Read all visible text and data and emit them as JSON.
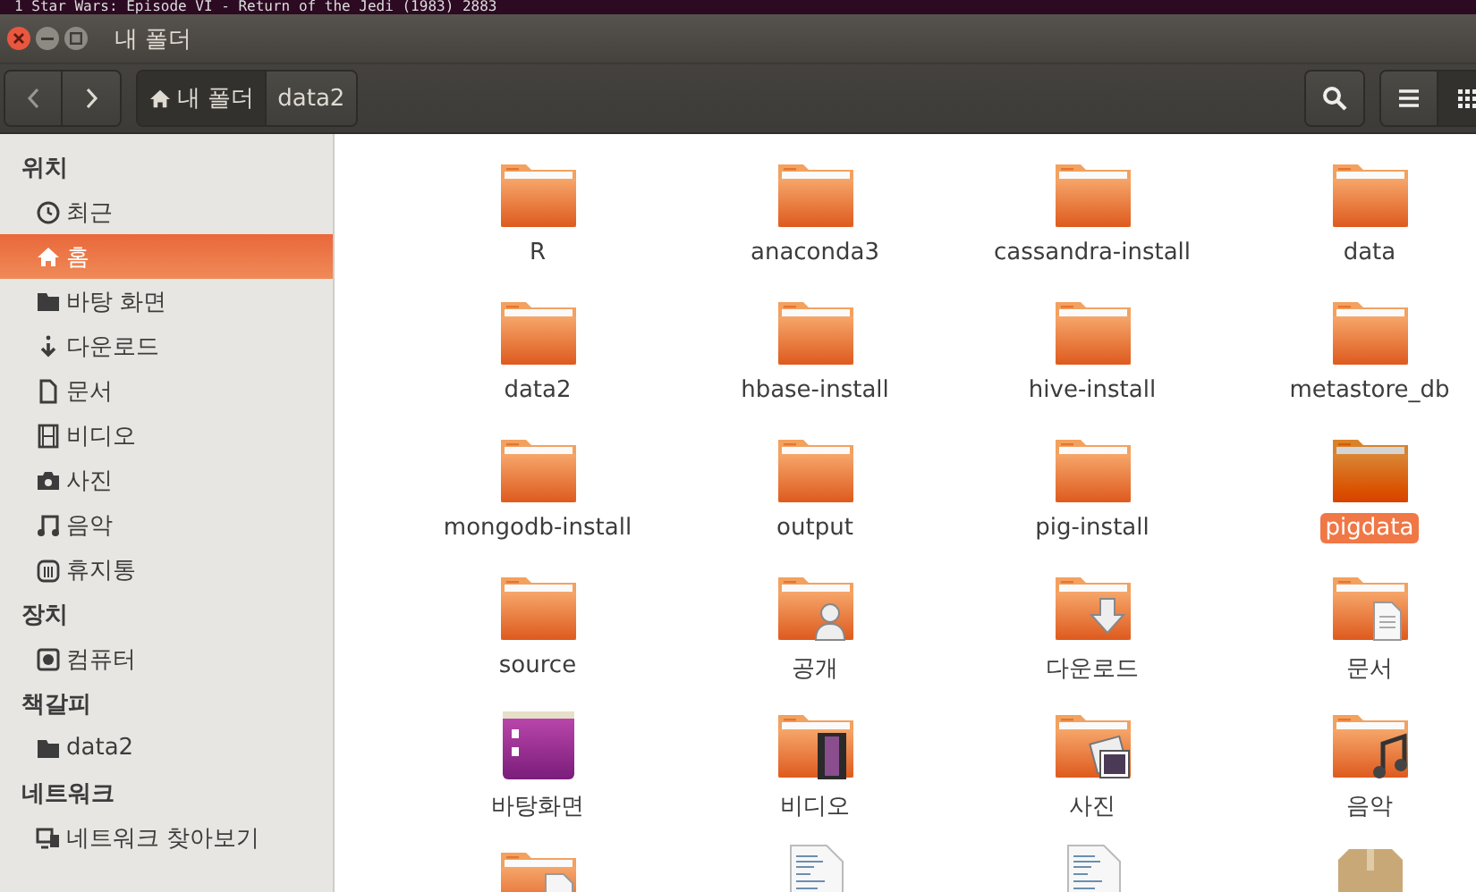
{
  "terminal_strip": {
    "text": "1     Star Wars: Episode VI - Return of the Jedi (1983)    2883"
  },
  "window": {
    "title": "내 폴더"
  },
  "toolbar": {
    "path": [
      {
        "label": "내 폴더",
        "kind": "home",
        "selected": true
      },
      {
        "label": "data2",
        "kind": "folder",
        "selected": false
      }
    ],
    "view": [
      {
        "kind": "list",
        "selected": false
      },
      {
        "kind": "grid",
        "selected": true
      }
    ]
  },
  "sidebar": {
    "sections": [
      {
        "heading": "위치",
        "items": [
          {
            "label": "최근",
            "kind": "clock",
            "selected": false
          },
          {
            "label": "홈",
            "kind": "home",
            "selected": true
          },
          {
            "label": "바탕 화면",
            "kind": "folder",
            "selected": false
          },
          {
            "label": "다운로드",
            "kind": "download",
            "selected": false
          },
          {
            "label": "문서",
            "kind": "document",
            "selected": false
          },
          {
            "label": "비디오",
            "kind": "film",
            "selected": false
          },
          {
            "label": "사진",
            "kind": "camera",
            "selected": false
          },
          {
            "label": "음악",
            "kind": "music",
            "selected": false
          },
          {
            "label": "휴지통",
            "kind": "trash",
            "selected": false
          }
        ]
      },
      {
        "heading": "장치",
        "items": [
          {
            "label": "컴퓨터",
            "kind": "disk",
            "selected": false
          }
        ]
      },
      {
        "heading": "책갈피",
        "items": [
          {
            "label": "data2",
            "kind": "folder",
            "selected": false
          }
        ]
      },
      {
        "heading": "네트워크",
        "items": [
          {
            "label": "네트워크 찾아보기",
            "kind": "network",
            "selected": false
          }
        ]
      }
    ]
  },
  "files": [
    {
      "label": "R",
      "kind": "folder",
      "selected": false
    },
    {
      "label": "anaconda3",
      "kind": "folder",
      "selected": false
    },
    {
      "label": "cassandra-install",
      "kind": "folder",
      "selected": false
    },
    {
      "label": "data",
      "kind": "folder",
      "selected": false
    },
    {
      "label": "data2",
      "kind": "folder",
      "selected": false
    },
    {
      "label": "hbase-install",
      "kind": "folder",
      "selected": false
    },
    {
      "label": "hive-install",
      "kind": "folder",
      "selected": false
    },
    {
      "label": "metastore_db",
      "kind": "folder",
      "selected": false
    },
    {
      "label": "mongodb-install",
      "kind": "folder",
      "selected": false
    },
    {
      "label": "output",
      "kind": "folder",
      "selected": false
    },
    {
      "label": "pig-install",
      "kind": "folder",
      "selected": false
    },
    {
      "label": "pigdata",
      "kind": "folder",
      "selected": true
    },
    {
      "label": "source",
      "kind": "folder",
      "selected": false
    },
    {
      "label": "공개",
      "kind": "folder-user",
      "selected": false
    },
    {
      "label": "다운로드",
      "kind": "folder-download",
      "selected": false
    },
    {
      "label": "문서",
      "kind": "folder-document",
      "selected": false
    },
    {
      "label": "바탕화면",
      "kind": "desktop",
      "selected": false
    },
    {
      "label": "비디오",
      "kind": "folder-video",
      "selected": false
    },
    {
      "label": "사진",
      "kind": "folder-photo",
      "selected": false
    },
    {
      "label": "음악",
      "kind": "folder-music",
      "selected": false
    },
    {
      "kind": "folder-template",
      "selected": false
    },
    {
      "kind": "text-file",
      "selected": false
    },
    {
      "kind": "text-file",
      "selected": false
    },
    {
      "kind": "package",
      "selected": false
    }
  ]
}
